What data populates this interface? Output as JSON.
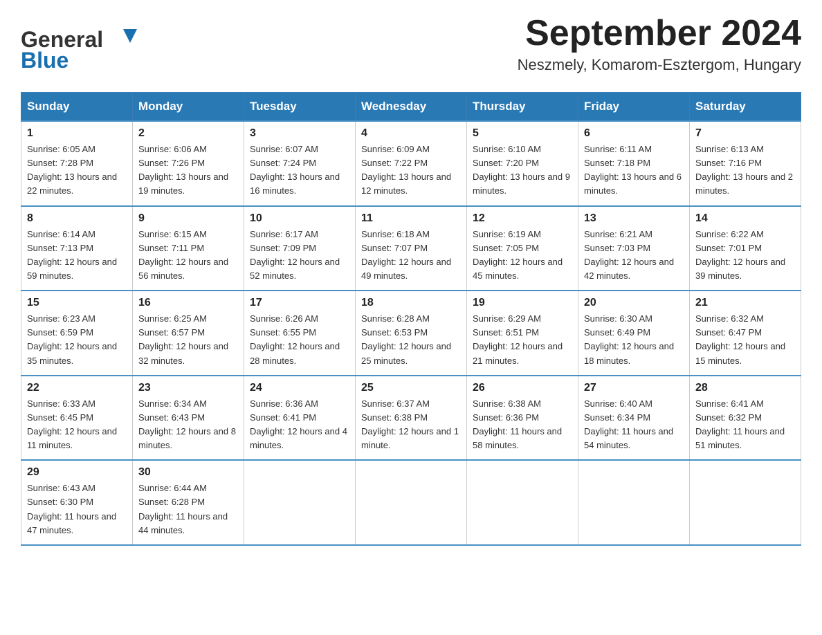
{
  "header": {
    "logo_general": "General",
    "logo_blue": "Blue",
    "month_title": "September 2024",
    "subtitle": "Neszmely, Komarom-Esztergom, Hungary"
  },
  "weekdays": [
    "Sunday",
    "Monday",
    "Tuesday",
    "Wednesday",
    "Thursday",
    "Friday",
    "Saturday"
  ],
  "weeks": [
    [
      {
        "day": "1",
        "sunrise": "6:05 AM",
        "sunset": "7:28 PM",
        "daylight": "13 hours and 22 minutes."
      },
      {
        "day": "2",
        "sunrise": "6:06 AM",
        "sunset": "7:26 PM",
        "daylight": "13 hours and 19 minutes."
      },
      {
        "day": "3",
        "sunrise": "6:07 AM",
        "sunset": "7:24 PM",
        "daylight": "13 hours and 16 minutes."
      },
      {
        "day": "4",
        "sunrise": "6:09 AM",
        "sunset": "7:22 PM",
        "daylight": "13 hours and 12 minutes."
      },
      {
        "day": "5",
        "sunrise": "6:10 AM",
        "sunset": "7:20 PM",
        "daylight": "13 hours and 9 minutes."
      },
      {
        "day": "6",
        "sunrise": "6:11 AM",
        "sunset": "7:18 PM",
        "daylight": "13 hours and 6 minutes."
      },
      {
        "day": "7",
        "sunrise": "6:13 AM",
        "sunset": "7:16 PM",
        "daylight": "13 hours and 2 minutes."
      }
    ],
    [
      {
        "day": "8",
        "sunrise": "6:14 AM",
        "sunset": "7:13 PM",
        "daylight": "12 hours and 59 minutes."
      },
      {
        "day": "9",
        "sunrise": "6:15 AM",
        "sunset": "7:11 PM",
        "daylight": "12 hours and 56 minutes."
      },
      {
        "day": "10",
        "sunrise": "6:17 AM",
        "sunset": "7:09 PM",
        "daylight": "12 hours and 52 minutes."
      },
      {
        "day": "11",
        "sunrise": "6:18 AM",
        "sunset": "7:07 PM",
        "daylight": "12 hours and 49 minutes."
      },
      {
        "day": "12",
        "sunrise": "6:19 AM",
        "sunset": "7:05 PM",
        "daylight": "12 hours and 45 minutes."
      },
      {
        "day": "13",
        "sunrise": "6:21 AM",
        "sunset": "7:03 PM",
        "daylight": "12 hours and 42 minutes."
      },
      {
        "day": "14",
        "sunrise": "6:22 AM",
        "sunset": "7:01 PM",
        "daylight": "12 hours and 39 minutes."
      }
    ],
    [
      {
        "day": "15",
        "sunrise": "6:23 AM",
        "sunset": "6:59 PM",
        "daylight": "12 hours and 35 minutes."
      },
      {
        "day": "16",
        "sunrise": "6:25 AM",
        "sunset": "6:57 PM",
        "daylight": "12 hours and 32 minutes."
      },
      {
        "day": "17",
        "sunrise": "6:26 AM",
        "sunset": "6:55 PM",
        "daylight": "12 hours and 28 minutes."
      },
      {
        "day": "18",
        "sunrise": "6:28 AM",
        "sunset": "6:53 PM",
        "daylight": "12 hours and 25 minutes."
      },
      {
        "day": "19",
        "sunrise": "6:29 AM",
        "sunset": "6:51 PM",
        "daylight": "12 hours and 21 minutes."
      },
      {
        "day": "20",
        "sunrise": "6:30 AM",
        "sunset": "6:49 PM",
        "daylight": "12 hours and 18 minutes."
      },
      {
        "day": "21",
        "sunrise": "6:32 AM",
        "sunset": "6:47 PM",
        "daylight": "12 hours and 15 minutes."
      }
    ],
    [
      {
        "day": "22",
        "sunrise": "6:33 AM",
        "sunset": "6:45 PM",
        "daylight": "12 hours and 11 minutes."
      },
      {
        "day": "23",
        "sunrise": "6:34 AM",
        "sunset": "6:43 PM",
        "daylight": "12 hours and 8 minutes."
      },
      {
        "day": "24",
        "sunrise": "6:36 AM",
        "sunset": "6:41 PM",
        "daylight": "12 hours and 4 minutes."
      },
      {
        "day": "25",
        "sunrise": "6:37 AM",
        "sunset": "6:38 PM",
        "daylight": "12 hours and 1 minute."
      },
      {
        "day": "26",
        "sunrise": "6:38 AM",
        "sunset": "6:36 PM",
        "daylight": "11 hours and 58 minutes."
      },
      {
        "day": "27",
        "sunrise": "6:40 AM",
        "sunset": "6:34 PM",
        "daylight": "11 hours and 54 minutes."
      },
      {
        "day": "28",
        "sunrise": "6:41 AM",
        "sunset": "6:32 PM",
        "daylight": "11 hours and 51 minutes."
      }
    ],
    [
      {
        "day": "29",
        "sunrise": "6:43 AM",
        "sunset": "6:30 PM",
        "daylight": "11 hours and 47 minutes."
      },
      {
        "day": "30",
        "sunrise": "6:44 AM",
        "sunset": "6:28 PM",
        "daylight": "11 hours and 44 minutes."
      },
      null,
      null,
      null,
      null,
      null
    ]
  ],
  "labels": {
    "sunrise": "Sunrise:",
    "sunset": "Sunset:",
    "daylight": "Daylight:"
  }
}
